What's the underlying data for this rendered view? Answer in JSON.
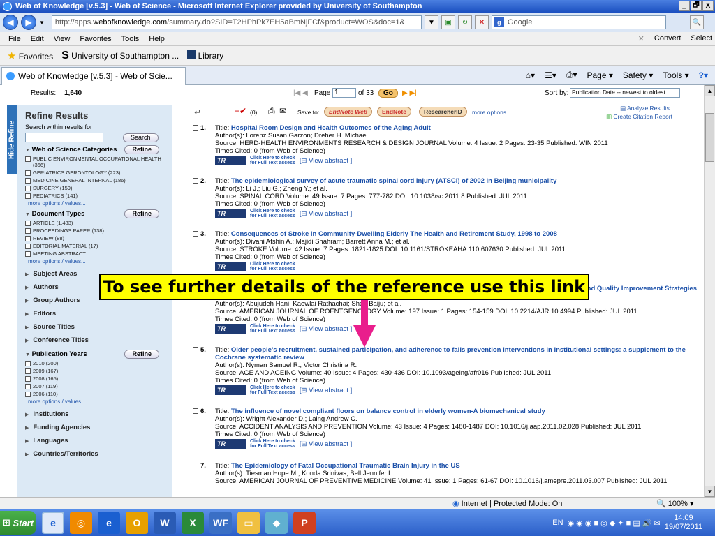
{
  "window": {
    "title": "Web of Knowledge [v.5.3] - Web of Science - Microsoft Internet Explorer provided by University of Southampton",
    "min": "_",
    "max": "🗗",
    "close": "X"
  },
  "address": {
    "url_prefix": "http://apps.",
    "url_domain": "webofknowledge.com",
    "url_rest": "/summary.do?SID=T2HPhPk7EH5aBmNjFCf&product=WOS&doc=1&",
    "search_placeholder": "Google",
    "search_icon": "🔍"
  },
  "menu": {
    "items": [
      "File",
      "Edit",
      "View",
      "Favorites",
      "Tools",
      "Help"
    ],
    "right": [
      "✕",
      "Convert",
      "Select"
    ]
  },
  "favorites": {
    "label": "Favorites",
    "items": [
      "University of Southampton ...",
      "Library"
    ]
  },
  "tabs": {
    "active": "Web of Knowledge [v.5.3] - Web of Scie...",
    "tools": [
      "Page",
      "Safety",
      "Tools"
    ]
  },
  "topline": {
    "results_label": "Results:",
    "results_count": "1,640",
    "page_label": "Page",
    "page_value": "1",
    "of_pages": "of 33",
    "go": "Go",
    "sort_label": "Sort by:",
    "sort_value": "Publication Date -- newest to oldest"
  },
  "sidebar": {
    "hide": "Hide Refine",
    "title": "Refine Results",
    "search_within": "Search within results for",
    "search_button": "Search",
    "wos_categories": {
      "title": "Web of Science Categories",
      "button": "Refine",
      "items": [
        "PUBLIC ENVIRONMENTAL OCCUPATIONAL HEALTH (366)",
        "GERIATRICS GERONTOLOGY (223)",
        "MEDICINE GENERAL INTERNAL (186)",
        "SURGERY (159)",
        "PEDIATRICS (141)"
      ],
      "more": "more options / values..."
    },
    "doc_types": {
      "title": "Document Types",
      "button": "Refine",
      "items": [
        "ARTICLE (1,483)",
        "PROCEEDINGS PAPER (138)",
        "REVIEW (88)",
        "EDITORIAL MATERIAL (17)",
        "MEETING ABSTRACT"
      ],
      "more": "more options / values..."
    },
    "collapsed1": [
      "Subject Areas",
      "Authors",
      "Group Authors",
      "Editors",
      "Source Titles",
      "Conference Titles"
    ],
    "pub_years": {
      "title": "Publication Years",
      "button": "Refine",
      "items": [
        "2010 (200)",
        "2009 (167)",
        "2008 (165)",
        "2007 (119)",
        "2006 (110)"
      ],
      "more": "more options / values..."
    },
    "collapsed2": [
      "Institutions",
      "Funding Agencies",
      "Languages",
      "Countries/Territories"
    ]
  },
  "toolbar": {
    "count": "(0)",
    "save_to": "Save to:",
    "endnote_web": "EndNote Web",
    "endnote": "EndNote",
    "researcherid": "ResearcherID",
    "more_options": "more options",
    "analyze": "Analyze Results",
    "citation_report": "Create Citation Report"
  },
  "records": [
    {
      "num": "1.",
      "title": "Hospital Room Design and Health Outcomes of the Aging Adult",
      "authors": "Author(s): Lorenz Susan Garzon; Dreher H. Michael",
      "source": "Source: HERD-HEALTH ENVIRONMENTS RESEARCH & DESIGN JOURNAL  Volume: 4  Issue: 2  Pages: 23-35  Published: WIN 2011",
      "cited": "Times Cited: 0 (from Web of Science)"
    },
    {
      "num": "2.",
      "title": "The epidemiological survey of acute traumatic spinal cord injury (ATSCI) of 2002 in Beijing municipality",
      "authors": "Author(s): Li J.; Liu G.; Zheng Y.; et al.",
      "source": "Source: SPINAL CORD  Volume: 49  Issue: 7  Pages: 777-782  DOI: 10.1038/sc.2011.8  Published: JUL 2011",
      "cited": "Times Cited: 0 (from Web of Science)"
    },
    {
      "num": "3.",
      "title": "Consequences of Stroke in Community-Dwelling Elderly The Health and Retirement Study, 1998 to 2008",
      "authors": "Author(s): Divani Afshin A.; Majidi Shahram; Barrett Anna M.; et al.",
      "source": "Source: STROKE  Volume: 42  Issue: 7  Pages: 1821-1825  DOI: 10.1161/STROKEAHA.110.607630  Published: JUL 2011",
      "cited": "Times Cited: 0 (from Web of Science)"
    },
    {
      "num": "4.",
      "title": "Outcomes, and Quality Improvement Strategies",
      "authors": "Author(s): Abujudeh Hani; Kaewlai Rathachai; Shah Baiju; et al.",
      "source": "Source: AMERICAN JOURNAL OF ROENTGENOLOGY  Volume: 197  Issue: 1  Pages: 154-159  DOI: 10.2214/AJR.10.4994  Published: JUL 2011",
      "cited": "Times Cited: 0 (from Web of Science)"
    },
    {
      "num": "5.",
      "title": "Older people's recruitment, sustained participation, and adherence to falls prevention interventions in institutional settings: a supplement to the Cochrane systematic review",
      "authors": "Author(s): Nyman Samuel R.; Victor Christina R.",
      "source": "Source: AGE AND AGEING  Volume: 40  Issue: 4  Pages: 430-436  DOI: 10.1093/ageing/afr016  Published: JUL 2011",
      "cited": "Times Cited: 0 (from Web of Science)"
    },
    {
      "num": "6.",
      "title": "The influence of novel compliant floors on balance control in elderly women-A biomechanical study",
      "authors": "Author(s): Wright Alexander D.; Laing Andrew C.",
      "source": "Source: ACCIDENT ANALYSIS AND PREVENTION  Volume: 43  Issue: 4  Pages: 1480-1487  DOI: 10.1016/j.aap.2011.02.028  Published: JUL 2011",
      "cited": "Times Cited: 0 (from Web of Science)"
    },
    {
      "num": "7.",
      "title": "The Epidemiology of Fatal Occupational Traumatic Brain Injury in the US",
      "authors": "Author(s): Tiesman Hope M.; Konda Srinivas; Bell Jennifer L.",
      "source": "Source: AMERICAN JOURNAL OF PREVENTIVE MEDICINE  Volume: 41  Issue: 1  Pages: 61-67  DOI: 10.1016/j.amepre.2011.03.007  Published: JUL 2011",
      "cited": ""
    }
  ],
  "record_common": {
    "title_label": "Title:",
    "click_here": "Click Here to check",
    "full_text": "for Full Text access",
    "view_abstract": "[⊞ View abstract ]",
    "tr_logo": "TR"
  },
  "callout": {
    "text": "To see further details of the reference use this link",
    "arrow_color": "#e91e8c"
  },
  "status": {
    "zone": "Internet | Protected Mode: On",
    "zoom": "100%"
  },
  "taskbar": {
    "start": "Start",
    "lang": "EN",
    "time": "14:09",
    "date": "19/07/2011"
  }
}
